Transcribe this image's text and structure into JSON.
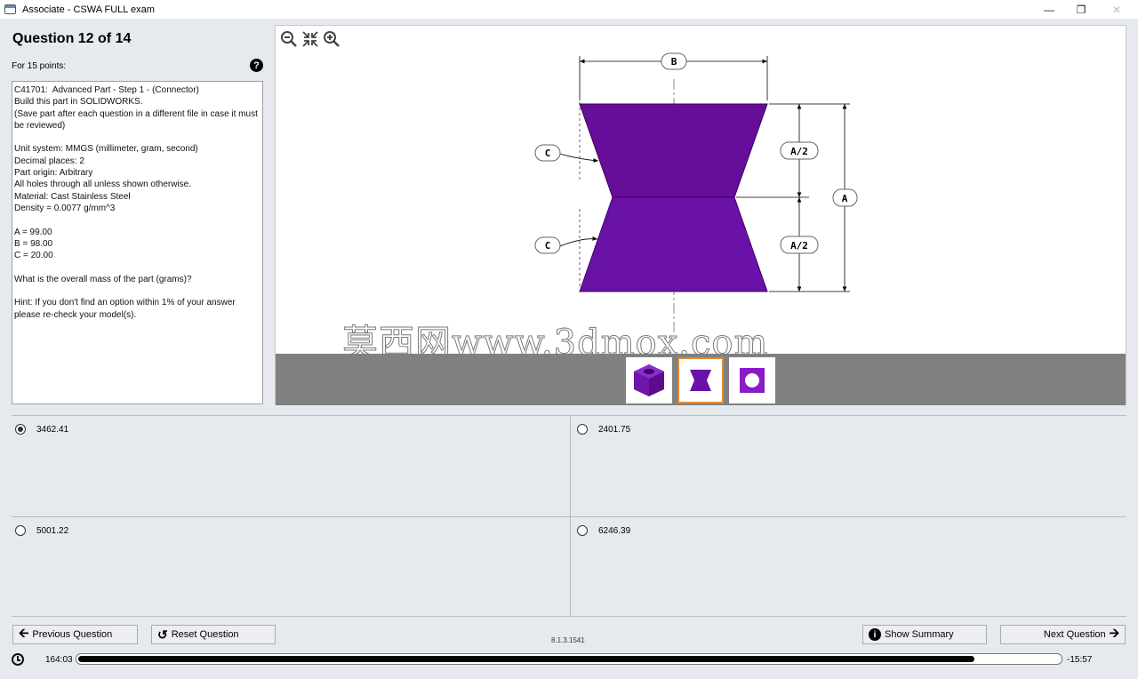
{
  "window": {
    "title": "Associate - CSWA FULL exam"
  },
  "question": {
    "heading": "Question 12 of 14",
    "points": "For 15 points:",
    "description": "C41701:  Advanced Part - Step 1 - (Connector)\nBuild this part in SOLIDWORKS.\n(Save part after each question in a different file in case it must be reviewed)\n\nUnit system: MMGS (millimeter, gram, second)\nDecimal places: 2\nPart origin: Arbitrary\nAll holes through all unless shown otherwise.\nMaterial: Cast Stainless Steel\nDensity = 0.0077 g/mm^3\n\nA = 99.00\nB = 98.00\nC = 20.00\n\nWhat is the overall mass of the part (grams)?\n\nHint: If you don't find an option within 1% of your answer please re-check your model(s)."
  },
  "drawing": {
    "labels": {
      "b": "B",
      "c_top": "C",
      "c_bottom": "C",
      "a_half_top": "A/2",
      "a_half_bottom": "A/2",
      "a": "A"
    },
    "part_color": "#6a0dad",
    "selected_thumbnail": 2,
    "watermark": "莫西网www.3dmox.com"
  },
  "answers": [
    {
      "label": "3462.41",
      "selected": true
    },
    {
      "label": "2401.75",
      "selected": false
    },
    {
      "label": "5001.22",
      "selected": false
    },
    {
      "label": "6246.39",
      "selected": false
    }
  ],
  "nav": {
    "previous": "Previous Question",
    "reset": "Reset Question",
    "version": "8.1.3.1541",
    "summary": "Show Summary",
    "next": "Next Question"
  },
  "timer": {
    "elapsed": "164:03",
    "remaining": "-15:57",
    "progress": 0.913
  }
}
